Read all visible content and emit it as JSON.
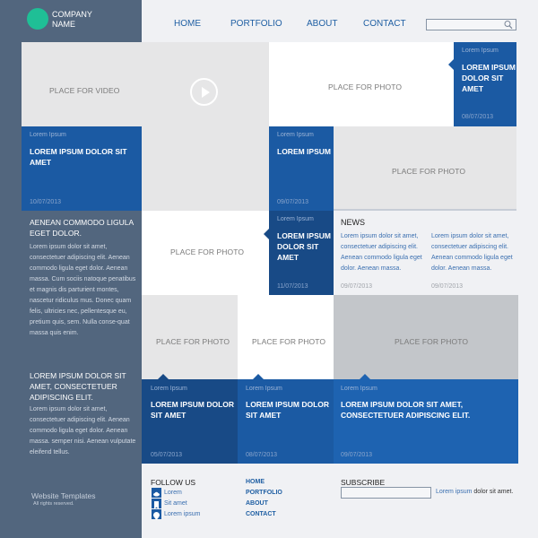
{
  "brand": {
    "company_name_line1": "COMPANY",
    "company_name_line2": "NAME",
    "logo_color": "#1fbf96"
  },
  "nav": {
    "items": [
      "HOME",
      "PORTFOLIO",
      "ABOUT",
      "CONTACT"
    ],
    "search_placeholder": ""
  },
  "colors": {
    "sidebar": "#52667e",
    "primary_blue": "#1b5aa3",
    "dark_blue": "#184a86",
    "light_blue": "#1e63b1",
    "background": "#f0f1f4"
  },
  "tiles": {
    "video": {
      "placeholder": "PLACE FOR VIDEO",
      "caption_kicker": "Lorem Ipsum",
      "caption_title": "LOREM IPSUM DOLOR SIT AMET",
      "caption_date": "10/07/2013"
    },
    "photo_top": {
      "placeholder": "PLACE FOR PHOTO",
      "caption_kicker": "Lorem Ipsum",
      "caption_title": "LOREM IPSUM DOLOR SIT AMET",
      "caption_date": "08/07/2013"
    },
    "photo_mid": {
      "placeholder": "PLACE FOR PHOTO",
      "caption_kicker": "Lorem Ipsum",
      "caption_title": "LOREM IPSUM",
      "caption_date": "09/07/2013"
    },
    "photo_left": {
      "placeholder": "PLACE FOR PHOTO",
      "caption_kicker": "Lorem Ipsum",
      "caption_title": "LOREM IPSUM DOLOR SIT AMET",
      "caption_date": "11/07/2013"
    },
    "row_photos": [
      {
        "placeholder": "PLACE FOR PHOTO",
        "caption_kicker": "Lorem Ipsum",
        "caption_title": "LOREM IPSUM DOLOR SIT AMET",
        "caption_date": "05/07/2013"
      },
      {
        "placeholder": "PLACE FOR PHOTO",
        "caption_kicker": "Lorem Ipsum",
        "caption_title": "LOREM IPSUM DOLOR SIT AMET",
        "caption_date": "08/07/2013"
      },
      {
        "placeholder": "PLACE FOR PHOTO",
        "caption_kicker": "Lorem Ipsum",
        "caption_title": "LOREM IPSUM DOLOR SIT AMET, CONSECTETUER ADIPISCING ELIT.",
        "caption_date": "09/07/2013"
      }
    ]
  },
  "news": {
    "heading": "NEWS",
    "items": [
      {
        "text": "Lorem ipsum dolor sit amet, consectetuer adipiscing elit. Aenean commodo ligula eget dolor. Aenean massa.",
        "date": "09/07/2013"
      },
      {
        "text": "Lorem ipsum dolor sit amet, consectetuer adipiscing elit. Aenean commodo ligula eget dolor. Aenean massa.",
        "date": "09/07/2013"
      }
    ]
  },
  "sidebar": {
    "block1": {
      "heading": "AENEAN COMMODO LIGULA EGET DOLOR.",
      "body": "Lorem ipsum dolor sit amet, consectetuer adipiscing elit. Aenean commodo ligula eget dolor. Aenean massa. Cum sociis natoque penatibus et magnis dis parturient montes, nascetur ridiculus mus. Donec quam felis, ultricies nec, pellentesque eu, pretium quis, sem. Nulla conse-quat massa quis enim."
    },
    "block2": {
      "heading": "LOREM IPSUM DOLOR SIT AMET, CONSECTETUER ADIPISCING ELIT.",
      "body": "Lorem ipsum dolor sit amet, consectetuer adipiscing elit. Aenean commodo ligula eget dolor. Aenean massa. semper nisi. Aenean vulputate eleifend tellus."
    },
    "footer_title": "Website Templates",
    "footer_sub": "All rights reserved."
  },
  "footer": {
    "follow": {
      "heading": "FOLLOW US",
      "links": [
        {
          "label": "Lorem",
          "icon": "cloud-icon"
        },
        {
          "label": "Sit amet",
          "icon": "bookmark-icon"
        },
        {
          "label": "Lorem ipsum",
          "icon": "location-pin-icon"
        }
      ]
    },
    "nav": [
      "HOME",
      "PORTFOLIO",
      "ABOUT",
      "CONTACT"
    ],
    "subscribe": {
      "heading": "SUBSCRIBE",
      "input_placeholder": "",
      "note_link": "Lorem ipsum",
      "note_text": " dolor sit amet."
    }
  }
}
